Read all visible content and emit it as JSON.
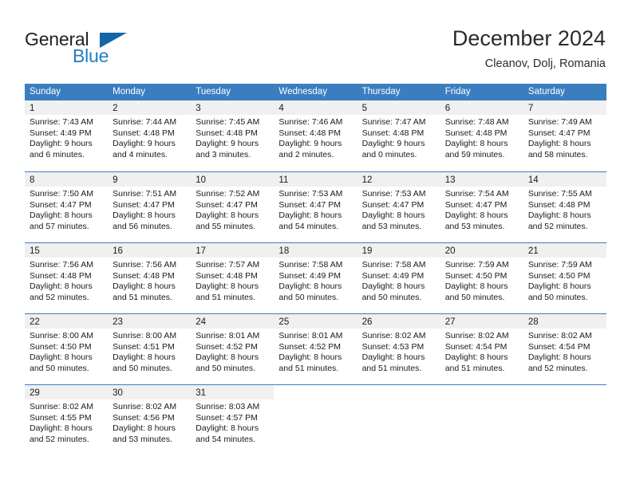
{
  "brand": {
    "word1": "General",
    "word2": "Blue",
    "triangle_color": "#1565a8",
    "blue_color": "#1f7fc4"
  },
  "header": {
    "title": "December 2024",
    "subtitle": "Cleanov, Dolj, Romania"
  },
  "theme": {
    "header_blue": "#3a7ebf",
    "day_band_gray": "#f0f0f0",
    "text_color": "#1a1a1a"
  },
  "weekdays": [
    "Sunday",
    "Monday",
    "Tuesday",
    "Wednesday",
    "Thursday",
    "Friday",
    "Saturday"
  ],
  "weeks": [
    [
      {
        "day": "1",
        "sunrise": "Sunrise: 7:43 AM",
        "sunset": "Sunset: 4:49 PM",
        "daylight1": "Daylight: 9 hours",
        "daylight2": "and 6 minutes."
      },
      {
        "day": "2",
        "sunrise": "Sunrise: 7:44 AM",
        "sunset": "Sunset: 4:48 PM",
        "daylight1": "Daylight: 9 hours",
        "daylight2": "and 4 minutes."
      },
      {
        "day": "3",
        "sunrise": "Sunrise: 7:45 AM",
        "sunset": "Sunset: 4:48 PM",
        "daylight1": "Daylight: 9 hours",
        "daylight2": "and 3 minutes."
      },
      {
        "day": "4",
        "sunrise": "Sunrise: 7:46 AM",
        "sunset": "Sunset: 4:48 PM",
        "daylight1": "Daylight: 9 hours",
        "daylight2": "and 2 minutes."
      },
      {
        "day": "5",
        "sunrise": "Sunrise: 7:47 AM",
        "sunset": "Sunset: 4:48 PM",
        "daylight1": "Daylight: 9 hours",
        "daylight2": "and 0 minutes."
      },
      {
        "day": "6",
        "sunrise": "Sunrise: 7:48 AM",
        "sunset": "Sunset: 4:48 PM",
        "daylight1": "Daylight: 8 hours",
        "daylight2": "and 59 minutes."
      },
      {
        "day": "7",
        "sunrise": "Sunrise: 7:49 AM",
        "sunset": "Sunset: 4:47 PM",
        "daylight1": "Daylight: 8 hours",
        "daylight2": "and 58 minutes."
      }
    ],
    [
      {
        "day": "8",
        "sunrise": "Sunrise: 7:50 AM",
        "sunset": "Sunset: 4:47 PM",
        "daylight1": "Daylight: 8 hours",
        "daylight2": "and 57 minutes."
      },
      {
        "day": "9",
        "sunrise": "Sunrise: 7:51 AM",
        "sunset": "Sunset: 4:47 PM",
        "daylight1": "Daylight: 8 hours",
        "daylight2": "and 56 minutes."
      },
      {
        "day": "10",
        "sunrise": "Sunrise: 7:52 AM",
        "sunset": "Sunset: 4:47 PM",
        "daylight1": "Daylight: 8 hours",
        "daylight2": "and 55 minutes."
      },
      {
        "day": "11",
        "sunrise": "Sunrise: 7:53 AM",
        "sunset": "Sunset: 4:47 PM",
        "daylight1": "Daylight: 8 hours",
        "daylight2": "and 54 minutes."
      },
      {
        "day": "12",
        "sunrise": "Sunrise: 7:53 AM",
        "sunset": "Sunset: 4:47 PM",
        "daylight1": "Daylight: 8 hours",
        "daylight2": "and 53 minutes."
      },
      {
        "day": "13",
        "sunrise": "Sunrise: 7:54 AM",
        "sunset": "Sunset: 4:47 PM",
        "daylight1": "Daylight: 8 hours",
        "daylight2": "and 53 minutes."
      },
      {
        "day": "14",
        "sunrise": "Sunrise: 7:55 AM",
        "sunset": "Sunset: 4:48 PM",
        "daylight1": "Daylight: 8 hours",
        "daylight2": "and 52 minutes."
      }
    ],
    [
      {
        "day": "15",
        "sunrise": "Sunrise: 7:56 AM",
        "sunset": "Sunset: 4:48 PM",
        "daylight1": "Daylight: 8 hours",
        "daylight2": "and 52 minutes."
      },
      {
        "day": "16",
        "sunrise": "Sunrise: 7:56 AM",
        "sunset": "Sunset: 4:48 PM",
        "daylight1": "Daylight: 8 hours",
        "daylight2": "and 51 minutes."
      },
      {
        "day": "17",
        "sunrise": "Sunrise: 7:57 AM",
        "sunset": "Sunset: 4:48 PM",
        "daylight1": "Daylight: 8 hours",
        "daylight2": "and 51 minutes."
      },
      {
        "day": "18",
        "sunrise": "Sunrise: 7:58 AM",
        "sunset": "Sunset: 4:49 PM",
        "daylight1": "Daylight: 8 hours",
        "daylight2": "and 50 minutes."
      },
      {
        "day": "19",
        "sunrise": "Sunrise: 7:58 AM",
        "sunset": "Sunset: 4:49 PM",
        "daylight1": "Daylight: 8 hours",
        "daylight2": "and 50 minutes."
      },
      {
        "day": "20",
        "sunrise": "Sunrise: 7:59 AM",
        "sunset": "Sunset: 4:50 PM",
        "daylight1": "Daylight: 8 hours",
        "daylight2": "and 50 minutes."
      },
      {
        "day": "21",
        "sunrise": "Sunrise: 7:59 AM",
        "sunset": "Sunset: 4:50 PM",
        "daylight1": "Daylight: 8 hours",
        "daylight2": "and 50 minutes."
      }
    ],
    [
      {
        "day": "22",
        "sunrise": "Sunrise: 8:00 AM",
        "sunset": "Sunset: 4:50 PM",
        "daylight1": "Daylight: 8 hours",
        "daylight2": "and 50 minutes."
      },
      {
        "day": "23",
        "sunrise": "Sunrise: 8:00 AM",
        "sunset": "Sunset: 4:51 PM",
        "daylight1": "Daylight: 8 hours",
        "daylight2": "and 50 minutes."
      },
      {
        "day": "24",
        "sunrise": "Sunrise: 8:01 AM",
        "sunset": "Sunset: 4:52 PM",
        "daylight1": "Daylight: 8 hours",
        "daylight2": "and 50 minutes."
      },
      {
        "day": "25",
        "sunrise": "Sunrise: 8:01 AM",
        "sunset": "Sunset: 4:52 PM",
        "daylight1": "Daylight: 8 hours",
        "daylight2": "and 51 minutes."
      },
      {
        "day": "26",
        "sunrise": "Sunrise: 8:02 AM",
        "sunset": "Sunset: 4:53 PM",
        "daylight1": "Daylight: 8 hours",
        "daylight2": "and 51 minutes."
      },
      {
        "day": "27",
        "sunrise": "Sunrise: 8:02 AM",
        "sunset": "Sunset: 4:54 PM",
        "daylight1": "Daylight: 8 hours",
        "daylight2": "and 51 minutes."
      },
      {
        "day": "28",
        "sunrise": "Sunrise: 8:02 AM",
        "sunset": "Sunset: 4:54 PM",
        "daylight1": "Daylight: 8 hours",
        "daylight2": "and 52 minutes."
      }
    ],
    [
      {
        "day": "29",
        "sunrise": "Sunrise: 8:02 AM",
        "sunset": "Sunset: 4:55 PM",
        "daylight1": "Daylight: 8 hours",
        "daylight2": "and 52 minutes."
      },
      {
        "day": "30",
        "sunrise": "Sunrise: 8:02 AM",
        "sunset": "Sunset: 4:56 PM",
        "daylight1": "Daylight: 8 hours",
        "daylight2": "and 53 minutes."
      },
      {
        "day": "31",
        "sunrise": "Sunrise: 8:03 AM",
        "sunset": "Sunset: 4:57 PM",
        "daylight1": "Daylight: 8 hours",
        "daylight2": "and 54 minutes."
      },
      {
        "day": "",
        "sunrise": "",
        "sunset": "",
        "daylight1": "",
        "daylight2": ""
      },
      {
        "day": "",
        "sunrise": "",
        "sunset": "",
        "daylight1": "",
        "daylight2": ""
      },
      {
        "day": "",
        "sunrise": "",
        "sunset": "",
        "daylight1": "",
        "daylight2": ""
      },
      {
        "day": "",
        "sunrise": "",
        "sunset": "",
        "daylight1": "",
        "daylight2": ""
      }
    ]
  ]
}
